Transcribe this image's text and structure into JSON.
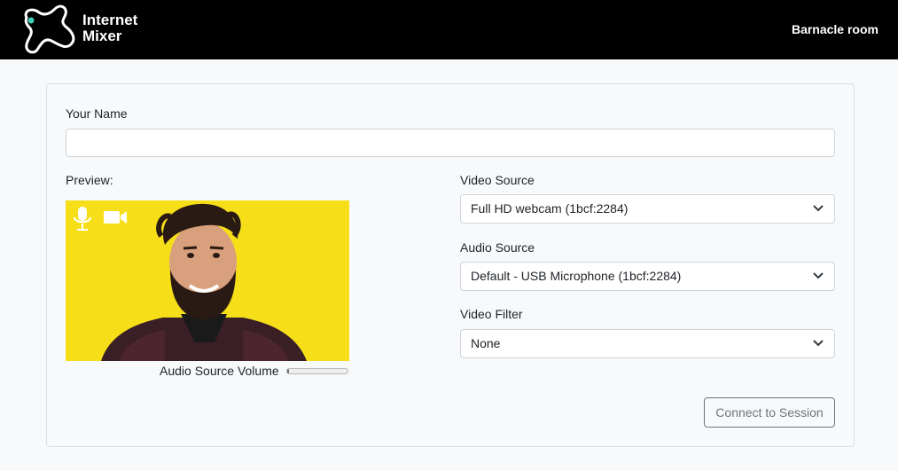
{
  "header": {
    "logo_line1": "Internet",
    "logo_line2": "Mixer",
    "room_name": "Barnacle room"
  },
  "form": {
    "name_label": "Your Name",
    "name_value": "",
    "name_placeholder": "",
    "preview_label": "Preview:",
    "volume_label": "Audio Source Volume",
    "volume_level_percent": 3,
    "video_source_label": "Video Source",
    "video_source_value": "Full HD webcam (1bcf:2284)",
    "audio_source_label": "Audio Source",
    "audio_source_value": "Default - USB Microphone (1bcf:2284)",
    "video_filter_label": "Video Filter",
    "video_filter_value": "None",
    "connect_label": "Connect to Session"
  },
  "icons": {
    "logo": "blob-logo-icon",
    "mic": "microphone-icon",
    "camera": "video-camera-icon",
    "dropdown": "chevron-down-icon"
  },
  "colors": {
    "header_bg": "#000000",
    "logo_dot": "#3fd0b8",
    "preview_bg": "#f6df18",
    "button_border": "#6c757d"
  }
}
